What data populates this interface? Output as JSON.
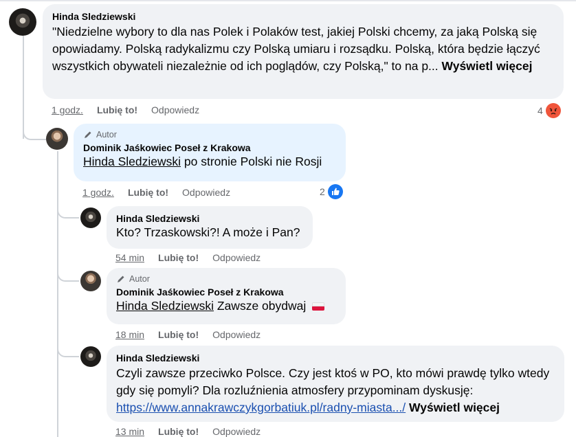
{
  "comments": [
    {
      "author": "Hinda Sledziewski",
      "text": "\"Niedzielne wybory to dla nas Polek i Polaków test, jakiej Polski chcemy, za jaką Polską się opowiadamy. Polską radykalizmu czy Polską umiaru i rozsądku. Polską, która będzie łączyć wszystkich obywateli niezależnie od ich poglądów, czy Polską,\" to na p...",
      "more": "Wyświetl więcej",
      "time": "1 godz.",
      "like": "Lubię to!",
      "reply": "Odpowiedz",
      "reaction_count": "4",
      "reaction_icon": "angry-emoji-icon"
    },
    {
      "badge": "Autor",
      "author": "Dominik Jaśkowiec Poseł z Krakowa",
      "mention": "Hinda Sledziewski",
      "text": " po stronie Polski nie Rosji",
      "time": "1 godz.",
      "like": "Lubię to!",
      "reply": "Odpowiedz",
      "reaction_count": "2",
      "reaction_icon": "thumbs-up-icon"
    },
    {
      "author": "Hinda Sledziewski",
      "text": "Kto? Trzaskowski?! A może i Pan?",
      "time": "54 min",
      "like": "Lubię to!",
      "reply": "Odpowiedz"
    },
    {
      "badge": "Autor",
      "author": "Dominik Jaśkowiec Poseł z Krakowa",
      "mention": "Hinda Sledziewski",
      "text": " Zawsze obydwaj",
      "time": "18 min",
      "like": "Lubię to!",
      "reply": "Odpowiedz"
    },
    {
      "author": "Hinda Sledziewski",
      "text": "Czyli zawsze przeciwko Polsce. Czy jest ktoś w PO, kto mówi prawdę tylko wtedy gdy się pomyli? Dla rozluźnienia atmosfery przypominam dyskusję:",
      "link": "https://www.annakrawczykgorbatiuk.pl/radny-miasta.../",
      "more": "Wyświetl więcej",
      "time": "13 min",
      "like": "Lubię to!",
      "reply": "Odpowiedz"
    }
  ],
  "colors": {
    "bubble": "#f0f2f5",
    "author_bubble": "#e7f3ff",
    "link": "#1a4fb0",
    "like_blue": "#1877f2",
    "angry": "#f0553b"
  }
}
